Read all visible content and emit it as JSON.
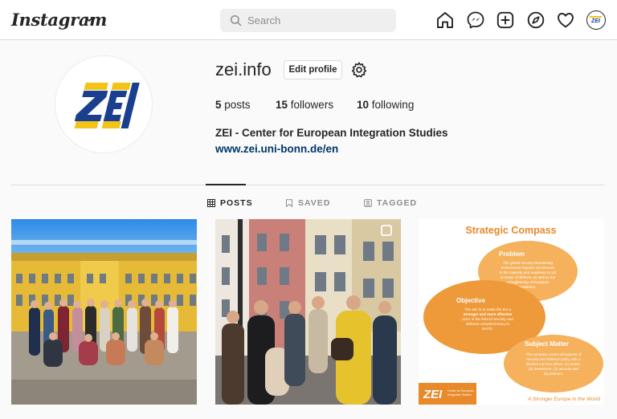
{
  "app": {
    "brand": "Instagram"
  },
  "search": {
    "placeholder": "Search",
    "value": ""
  },
  "nav": {
    "icons": [
      "home-icon",
      "messenger-icon",
      "new-post-icon",
      "explore-icon",
      "activity-heart-icon",
      "profile-avatar"
    ]
  },
  "profile": {
    "username": "zei.info",
    "edit_label": "Edit profile",
    "stats": {
      "posts_count": "5",
      "posts_label": "posts",
      "followers_count": "15",
      "followers_label": "followers",
      "following_count": "10",
      "following_label": "following"
    },
    "full_name": "ZEI - Center for European Integration Studies",
    "website": "www.zei.uni-bonn.de/en",
    "avatar_logo": "ZEI"
  },
  "tabs": [
    {
      "label": "POSTS",
      "icon": "grid-icon",
      "active": true
    },
    {
      "label": "SAVED",
      "icon": "bookmark-icon",
      "active": false
    },
    {
      "label": "TAGGED",
      "icon": "tagged-icon",
      "active": false
    }
  ],
  "posts": {
    "post3": {
      "title": "Strategic Compass",
      "problem_title": "Problem",
      "problem_text_1": "The global security-threatening",
      "problem_text_2": "environment requires an increase",
      "problem_text_3": "in the capacity and readiness to act",
      "problem_text_4": "at areas of defence, as well as the",
      "problem_text_5": "strengthening of European",
      "problem_text_6": "resilience.",
      "objective_title": "Objective",
      "objective_text_1": "The aim is to make the EU a",
      "objective_text_2": "stronger and more effective",
      "objective_text_3": "actor in the field of security and",
      "objective_text_4": "defence complementary to",
      "objective_text_5": "NATO.",
      "subject_title": "Subject Matter",
      "subject_text_1": "The compass covers all aspects of",
      "subject_text_2": "security and defence policy with a",
      "subject_text_3": "division into four pillars: (1) action,",
      "subject_text_4": "(2) investment, (3) security and",
      "subject_text_5": "(4) partners.",
      "footer_logo": "ZEI",
      "footer_org_1": "Center for European",
      "footer_org_2": "Integration Studies",
      "tagline": "A Stronger Europe in the World"
    }
  },
  "colors": {
    "accent_blue": "#1a3f8f",
    "accent_yellow": "#f2c417",
    "link": "#00376b",
    "compass_orange": "#ee9a3a"
  }
}
